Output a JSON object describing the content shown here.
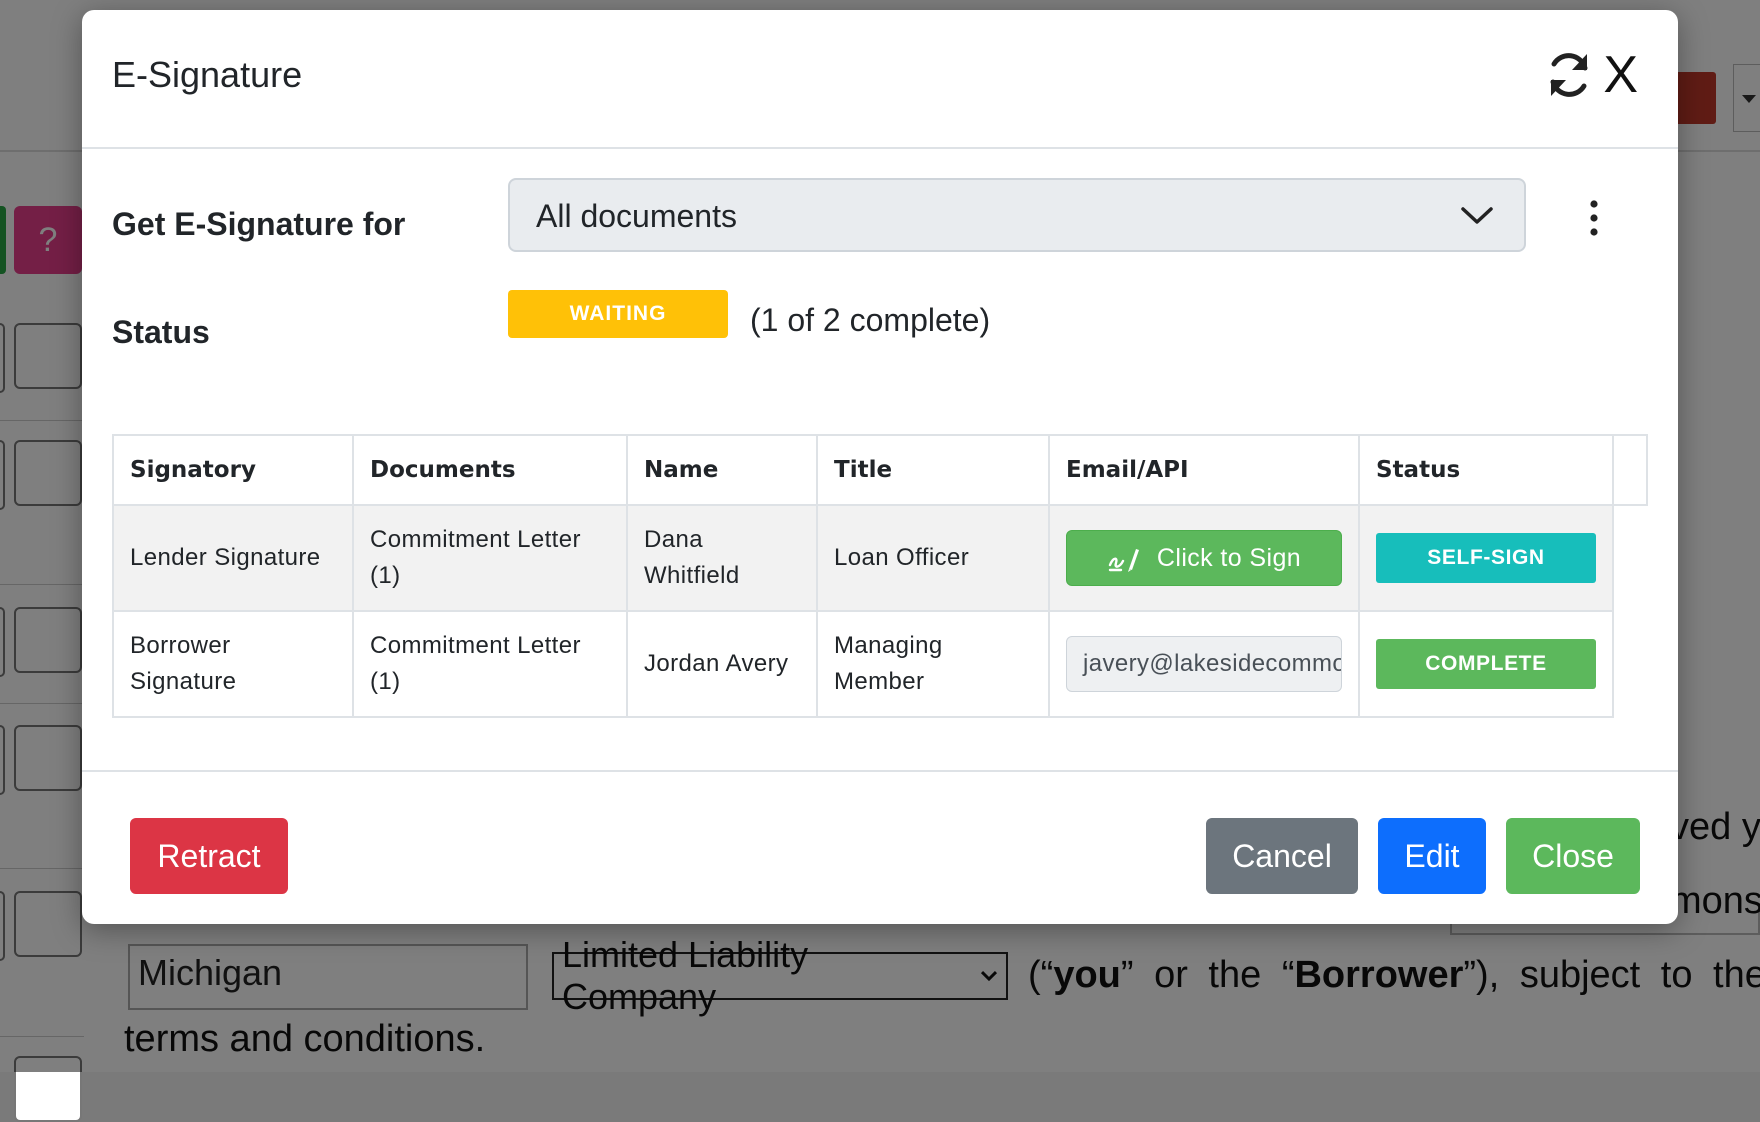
{
  "background": {
    "help_label": "?",
    "state_input": "Michigan",
    "entity_select": "Limited Liability Company",
    "sentence_open": "(“",
    "you_word": "you",
    "sentence_mid": "” or the “",
    "borrower_word": "Borrower",
    "sentence_end": "”), subject to the t",
    "line2": "terms and conditions.",
    "peek_ved": "ved y",
    "peek_mon": "mons"
  },
  "modal": {
    "title": "E-Signature",
    "close_label": "X",
    "get_for_label": "Get E-Signature for",
    "get_for_value": "All documents",
    "status_label": "Status",
    "status_badge": "WAITING",
    "status_progress": "(1 of 2 complete)",
    "colors": {
      "waiting": "#ffc107",
      "self_sign": "#17bebb",
      "complete": "#5cb85c",
      "retract": "#dc3545",
      "cancel": "#6c757d",
      "edit": "#0d6efd",
      "close": "#5cb85c"
    },
    "table": {
      "headers": [
        "Signatory",
        "Documents",
        "Name",
        "Title",
        "Email/API",
        "Status"
      ],
      "rows": [
        {
          "signatory": "Lender Signature",
          "documents": "Commitment Letter (1)",
          "name": "Dana Whitfield",
          "title": "Loan Officer",
          "action_label": "Click to Sign",
          "action_icon": "signature-icon",
          "status": "SELF-SIGN"
        },
        {
          "signatory": "Borrower Signature",
          "documents": "Commitment Letter (1)",
          "name": "Jordan Avery",
          "title": "Managing Member",
          "email": "javery@lakesidecommons.com",
          "status": "COMPLETE"
        }
      ]
    },
    "footer": {
      "retract": "Retract",
      "cancel": "Cancel",
      "edit": "Edit",
      "close": "Close"
    }
  }
}
